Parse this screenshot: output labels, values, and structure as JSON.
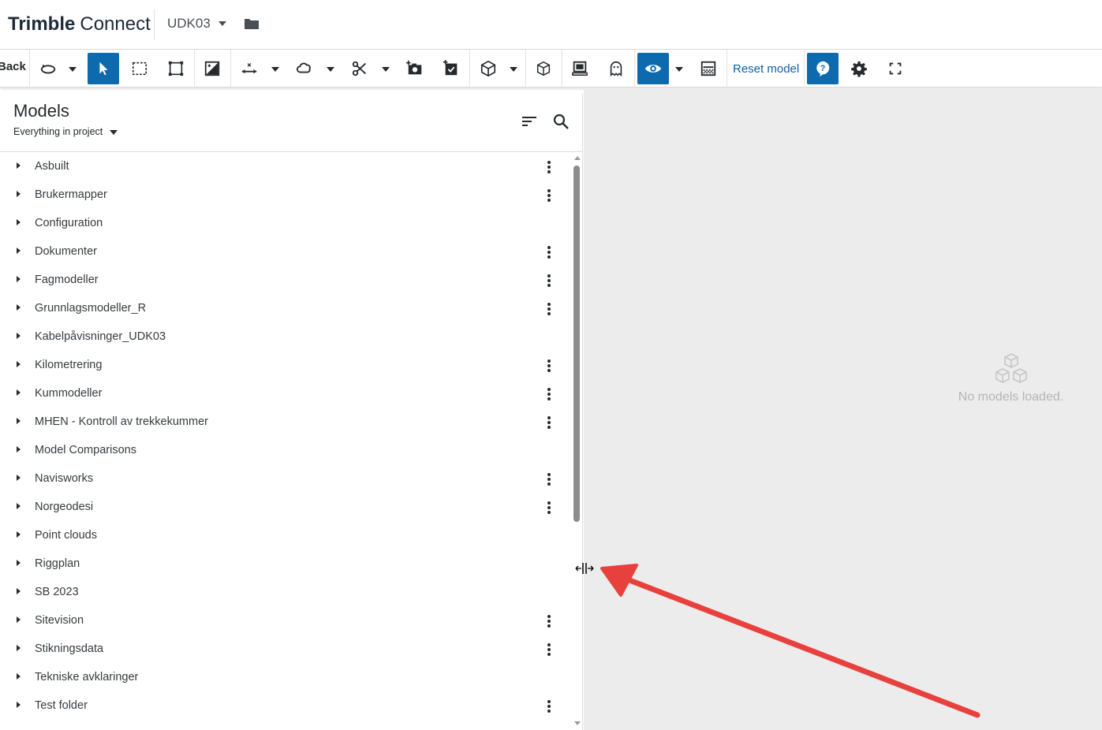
{
  "header": {
    "brand_part1": "Trimble",
    "brand_part2": "Connect",
    "project_name": "UDK03"
  },
  "toolbar": {
    "back_label": "Back",
    "reset_label": "Reset model",
    "accent_color": "#0d6aad"
  },
  "panel": {
    "title": "Models",
    "filter_label": "Everything in project",
    "items": [
      {
        "label": "Asbuilt",
        "has_menu": true
      },
      {
        "label": "Brukermapper",
        "has_menu": true
      },
      {
        "label": "Configuration",
        "has_menu": false
      },
      {
        "label": "Dokumenter",
        "has_menu": true
      },
      {
        "label": "Fagmodeller",
        "has_menu": true
      },
      {
        "label": "Grunnlagsmodeller_R",
        "has_menu": true
      },
      {
        "label": "Kabelpåvisninger_UDK03",
        "has_menu": false
      },
      {
        "label": "Kilometrering",
        "has_menu": true
      },
      {
        "label": "Kummodeller",
        "has_menu": true
      },
      {
        "label": "MHEN - Kontroll av trekkekummer",
        "has_menu": true
      },
      {
        "label": "Model Comparisons",
        "has_menu": false
      },
      {
        "label": "Navisworks",
        "has_menu": true
      },
      {
        "label": "Norgeodesi",
        "has_menu": true
      },
      {
        "label": "Point clouds",
        "has_menu": false
      },
      {
        "label": "Riggplan",
        "has_menu": false
      },
      {
        "label": "SB 2023",
        "has_menu": false
      },
      {
        "label": "Sitevision",
        "has_menu": true
      },
      {
        "label": "Stikningsdata",
        "has_menu": true
      },
      {
        "label": "Tekniske avklaringer",
        "has_menu": false
      },
      {
        "label": "Test folder",
        "has_menu": true
      }
    ]
  },
  "viewer": {
    "empty_message": "No models loaded."
  },
  "annotation": {
    "arrow_color": "#e8413d"
  }
}
